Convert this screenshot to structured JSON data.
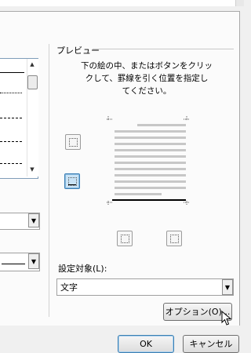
{
  "preview_group": {
    "title": "プレビュー",
    "description_line1": "下の絵の中、またはボタンをクリッ",
    "description_line2": "クして、罫線を引く位置を指定し",
    "description_line3": "てください。"
  },
  "apply_to": {
    "label": "設定対象(L):",
    "selected": "文字"
  },
  "options_button": {
    "label": "オプション(O)..."
  },
  "footer": {
    "ok_label": "OK",
    "cancel_label": "キャンセル"
  },
  "icons": {
    "border_box": "box-border-icon",
    "border_none": "no-border-icon",
    "border_left": "left-border-icon",
    "border_right": "right-border-icon",
    "dropdown": "chevron-down-icon",
    "cursor": "mouse-cursor-icon"
  },
  "colors": {
    "selection": "#c9e3f6",
    "selection_border": "#3b7fb7",
    "preview_lines": "#c7c7c7"
  }
}
